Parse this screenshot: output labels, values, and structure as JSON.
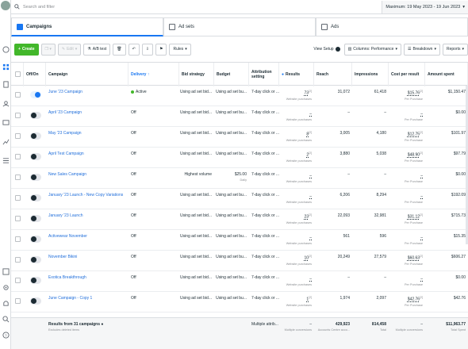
{
  "search": {
    "placeholder": "Search and filter"
  },
  "date_range": {
    "label": "Maximum: 19 May 2023 - 19 Jun 2023"
  },
  "tabs": [
    {
      "label": "Campaigns",
      "active": true
    },
    {
      "label": "Ad sets",
      "active": false
    },
    {
      "label": "Ads",
      "active": false
    }
  ],
  "toolbar": {
    "create": "Create",
    "edit": "Edit",
    "ab_test": "A/B test",
    "rules": "Rules",
    "view_setup": "View Setup",
    "columns": "Columns: Performance",
    "breakdown": "Breakdown",
    "reports": "Reports"
  },
  "columns": {
    "on_off": "Off/On",
    "campaign": "Campaign",
    "delivery": "Delivery ↑",
    "bid_strategy": "Bid strategy",
    "budget": "Budget",
    "attribution": "Attribution setting",
    "results": "Results",
    "reach": "Reach",
    "impressions": "Impressions",
    "cost_per_result": "Cost per result",
    "amount_spent": "Amount spent"
  },
  "rows": [
    {
      "on": true,
      "name": "June '23 Campaign",
      "delivery": "Active",
      "active": true,
      "bid": "Using ad set bid...",
      "budget": "Using ad set bu...",
      "budget_sub": "",
      "attr": "7-day click or ...",
      "results": "73",
      "results_sup": "[2]",
      "results_sub": "Website purchases",
      "reach": "31,072",
      "impr": "61,418",
      "cpr": "$15.76",
      "cpr_sup": "[2]",
      "cpr_sub": "Per Purchase",
      "spent": "$1,150.47"
    },
    {
      "on": false,
      "name": "April '23 Campaign",
      "delivery": "Off",
      "active": false,
      "bid": "Using ad set bid...",
      "budget": "Using ad set bu...",
      "budget_sub": "",
      "attr": "7-day click or ...",
      "results": "–",
      "results_sup": "",
      "results_sub": "Website purchases",
      "reach": "–",
      "impr": "–",
      "cpr": "–",
      "cpr_sup": "",
      "cpr_sub": "Per Purchase",
      "spent": "$0.00"
    },
    {
      "on": false,
      "name": "May '23 Campaign",
      "delivery": "Off",
      "active": false,
      "bid": "Using ad set bid...",
      "budget": "Using ad set bu...",
      "budget_sub": "",
      "attr": "7-day click or ...",
      "results": "8",
      "results_sup": "[2]",
      "results_sub": "Website purchases",
      "reach": "3,005",
      "impr": "4,180",
      "cpr": "$12.75",
      "cpr_sup": "[2]",
      "cpr_sub": "Per Purchase",
      "spent": "$101.97"
    },
    {
      "on": false,
      "name": "April Test Campaign",
      "delivery": "Off",
      "active": false,
      "bid": "Using ad set bid...",
      "budget": "Using ad set bu...",
      "budget_sub": "",
      "attr": "7-day click or ...",
      "results": "2",
      "results_sup": "[2]",
      "results_sub": "Website purchases",
      "reach": "3,880",
      "impr": "5,038",
      "cpr": "$48.90",
      "cpr_sup": "[2]",
      "cpr_sub": "Per Purchase",
      "spent": "$97.79"
    },
    {
      "on": false,
      "name": "New Sales Campaign",
      "delivery": "Off",
      "active": false,
      "bid": "Highest volume",
      "budget": "$25.00",
      "budget_sub": "Daily",
      "attr": "7-day click or ...",
      "results": "–",
      "results_sup": "",
      "results_sub": "Website purchases",
      "reach": "–",
      "impr": "–",
      "cpr": "–",
      "cpr_sup": "",
      "cpr_sub": "Per Purchase",
      "spent": "$0.00"
    },
    {
      "on": false,
      "name": "January '23 Launch - New Copy Variations",
      "delivery": "Off",
      "active": false,
      "bid": "Using ad set bid...",
      "budget": "Using ad set bu...",
      "budget_sub": "",
      "attr": "7-day click or ...",
      "results": "–",
      "results_sup": "",
      "results_sub": "Website purchases",
      "reach": "6,206",
      "impr": "8,294",
      "cpr": "–",
      "cpr_sup": "",
      "cpr_sub": "Per Purchase",
      "spent": "$192.09"
    },
    {
      "on": false,
      "name": "January '23 Launch",
      "delivery": "Off",
      "active": false,
      "bid": "Using ad set bid...",
      "budget": "Using ad set bu...",
      "budget_sub": "",
      "attr": "7-day click or ...",
      "results": "23",
      "results_sup": "[2]",
      "results_sub": "Website purchases",
      "reach": "22,093",
      "impr": "32,981",
      "cpr": "$31.12",
      "cpr_sup": "[2]",
      "cpr_sub": "Per Purchase",
      "spent": "$715.73"
    },
    {
      "on": false,
      "name": "Activewear November",
      "delivery": "Off",
      "active": false,
      "bid": "Using ad set bid...",
      "budget": "Using ad set bu...",
      "budget_sub": "",
      "attr": "7-day click or ...",
      "results": "–",
      "results_sup": "",
      "results_sub": "Website purchases",
      "reach": "561",
      "impr": "596",
      "cpr": "–",
      "cpr_sup": "",
      "cpr_sub": "Per Purchase",
      "spent": "$15.35"
    },
    {
      "on": false,
      "name": "November Bikini",
      "delivery": "Off",
      "active": false,
      "bid": "Using ad set bid...",
      "budget": "Using ad set bu...",
      "budget_sub": "",
      "attr": "7-day click or ...",
      "results": "10",
      "results_sup": "[2]",
      "results_sub": "Website purchases",
      "reach": "20,249",
      "impr": "27,579",
      "cpr": "$60.63",
      "cpr_sup": "[2]",
      "cpr_sub": "Per Purchase",
      "spent": "$606.27"
    },
    {
      "on": false,
      "name": "Exotica Breakthrough",
      "delivery": "Off",
      "active": false,
      "bid": "Using ad set bid...",
      "budget": "Using ad set bu...",
      "budget_sub": "",
      "attr": "7-day click or ...",
      "results": "–",
      "results_sup": "",
      "results_sub": "Website purchases",
      "reach": "–",
      "impr": "–",
      "cpr": "–",
      "cpr_sup": "",
      "cpr_sub": "Per Purchase",
      "spent": "$0.00"
    },
    {
      "on": false,
      "name": "June Campaign - Copy 1",
      "delivery": "Off",
      "active": false,
      "bid": "Using ad set bid...",
      "budget": "Using ad set bu...",
      "budget_sub": "",
      "attr": "7-day click or ...",
      "results": "1",
      "results_sup": "[2]",
      "results_sub": "Website purchases",
      "reach": "1,974",
      "impr": "2,097",
      "cpr": "$42.76",
      "cpr_sup": "[2]",
      "cpr_sub": "Per Purchase",
      "spent": "$42.76"
    }
  ],
  "footer": {
    "title": "Results from 31 campaigns",
    "subtitle": "Excludes deleted items",
    "attr": "Multiple attrib...",
    "results": "–",
    "results_sub": "Multiple conversions",
    "reach": "429,923",
    "reach_sub": "Accounts Centre acco...",
    "impr": "814,458",
    "impr_sub": "Total",
    "cpr": "–",
    "cpr_sub": "Multiple conversions",
    "spent": "$11,963.77",
    "spent_sub": "Total Spent"
  },
  "colors": {
    "accent": "#1877f2",
    "create": "#42b72a",
    "link": "#216fdb",
    "active_dot": "#42b72a"
  }
}
